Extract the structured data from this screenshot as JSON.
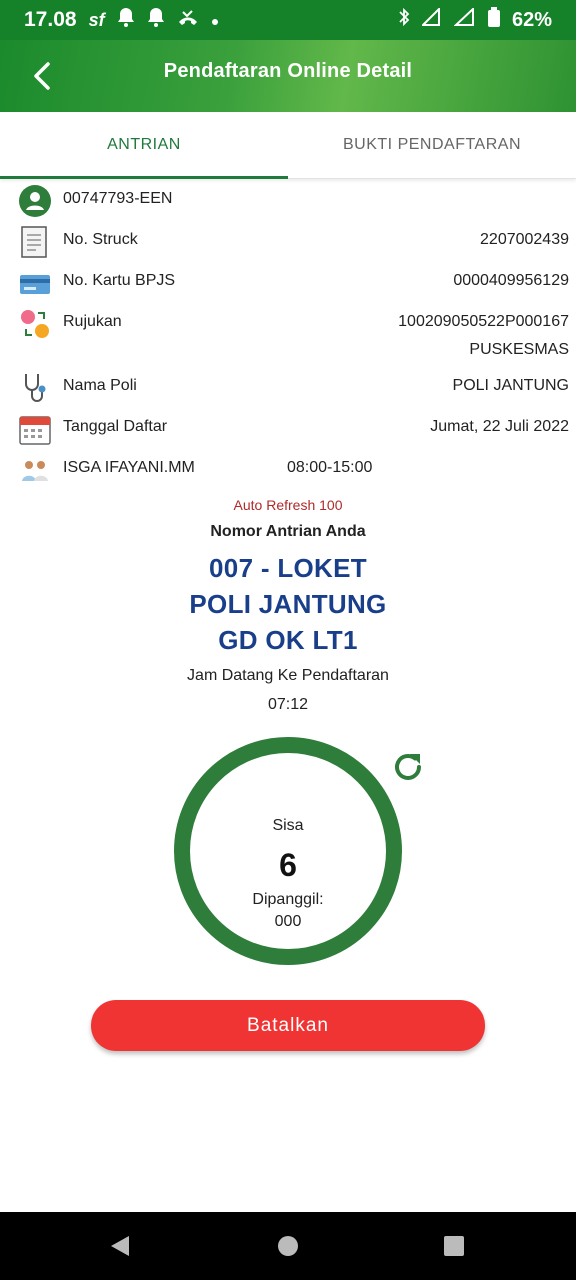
{
  "status_bar": {
    "time": "17.08",
    "carrier_icon": "sf",
    "battery": "62%"
  },
  "app_bar": {
    "title": "Pendaftaran Online Detail"
  },
  "tabs": [
    {
      "label": "ANTRIAN",
      "active": true
    },
    {
      "label": "BUKTI PENDAFTARAN",
      "active": false
    }
  ],
  "details": {
    "patient_id": "00747793-EEN",
    "struck": {
      "label": "No. Struck",
      "value": "2207002439"
    },
    "bpjs": {
      "label": "No. Kartu BPJS",
      "value": "0000409956129"
    },
    "rujukan": {
      "label": "Rujukan",
      "value": "100209050522P000167",
      "value2": "PUSKESMAS"
    },
    "poli": {
      "label": "Nama Poli",
      "value": "POLI JANTUNG"
    },
    "tanggal": {
      "label": "Tanggal Daftar",
      "value": "Jumat, 22 Juli 2022"
    },
    "dokter": {
      "name": "ISGA IFAYANI.MM",
      "hours": "08:00-15:00"
    }
  },
  "queue": {
    "auto_refresh": "Auto Refresh 100",
    "heading": "Nomor Antrian Anda",
    "line1": "007 - LOKET",
    "line2": "POLI JANTUNG",
    "line3": "GD OK LT1",
    "arrival_label": "Jam Datang Ke Pendaftaran",
    "arrival_time": "07:12",
    "sisa_label": "Sisa",
    "sisa_value": "6",
    "called_label": "Dipanggil:",
    "called_value": "000"
  },
  "cancel_button": {
    "label": "Batalkan"
  },
  "colors": {
    "primary_green": "#1f7a3c",
    "queue_blue": "#1a3f8a",
    "cancel_red": "#f03434",
    "auto_refresh_red": "#b02a2a"
  }
}
